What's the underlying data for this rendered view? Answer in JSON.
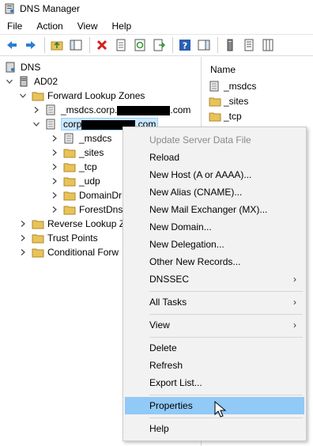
{
  "window": {
    "title": "DNS Manager"
  },
  "menubar": {
    "items": [
      "File",
      "Action",
      "View",
      "Help"
    ]
  },
  "toolbar": {
    "buttons": [
      "back-icon",
      "forward-icon",
      "up-folder-icon",
      "show-hide-tree-icon",
      "delete-icon",
      "properties-icon",
      "refresh-icon",
      "export-icon",
      "help-icon",
      "action-pane-icon",
      "server-icon",
      "server-list-icon",
      "server-columns-icon"
    ]
  },
  "tree": {
    "root": "DNS",
    "server": "AD02",
    "forward_zones": "Forward Lookup Zones",
    "msdcs_zone_prefix": "_msdcs.corp.",
    "msdcs_zone_suffix": ".com",
    "corp_zone_prefix": "corp",
    "corp_zone_suffix": ".com",
    "children": [
      "_msdcs",
      "_sites",
      "_tcp",
      "_udp",
      "DomainDr",
      "ForestDns"
    ],
    "reverse_zones": "Reverse Lookup Z",
    "trust_points": "Trust Points",
    "conditional_forwarders": "Conditional Forw"
  },
  "right_pane": {
    "column_header": "Name",
    "items": [
      "_msdcs",
      "_sites",
      "_tcp"
    ]
  },
  "context_menu": {
    "items": [
      {
        "label": "Update Server Data File",
        "disabled": true
      },
      {
        "label": "Reload"
      },
      {
        "label": "New Host (A or AAAA)..."
      },
      {
        "label": "New Alias (CNAME)..."
      },
      {
        "label": "New Mail Exchanger (MX)..."
      },
      {
        "label": "New Domain..."
      },
      {
        "label": "New Delegation..."
      },
      {
        "label": "Other New Records..."
      },
      {
        "label": "DNSSEC",
        "submenu": true
      },
      {
        "label": "All Tasks",
        "submenu": true
      },
      {
        "label": "View",
        "submenu": true
      },
      {
        "label": "Delete"
      },
      {
        "label": "Refresh"
      },
      {
        "label": "Export List..."
      },
      {
        "label": "Properties",
        "highlighted": true
      },
      {
        "label": "Help"
      }
    ],
    "submenu_glyph": "›"
  },
  "colors": {
    "selection": "#cce8ff",
    "menu_hover": "#91c9f7",
    "menu_bg": "#f2f2f2",
    "folder": "#e8c35a"
  }
}
